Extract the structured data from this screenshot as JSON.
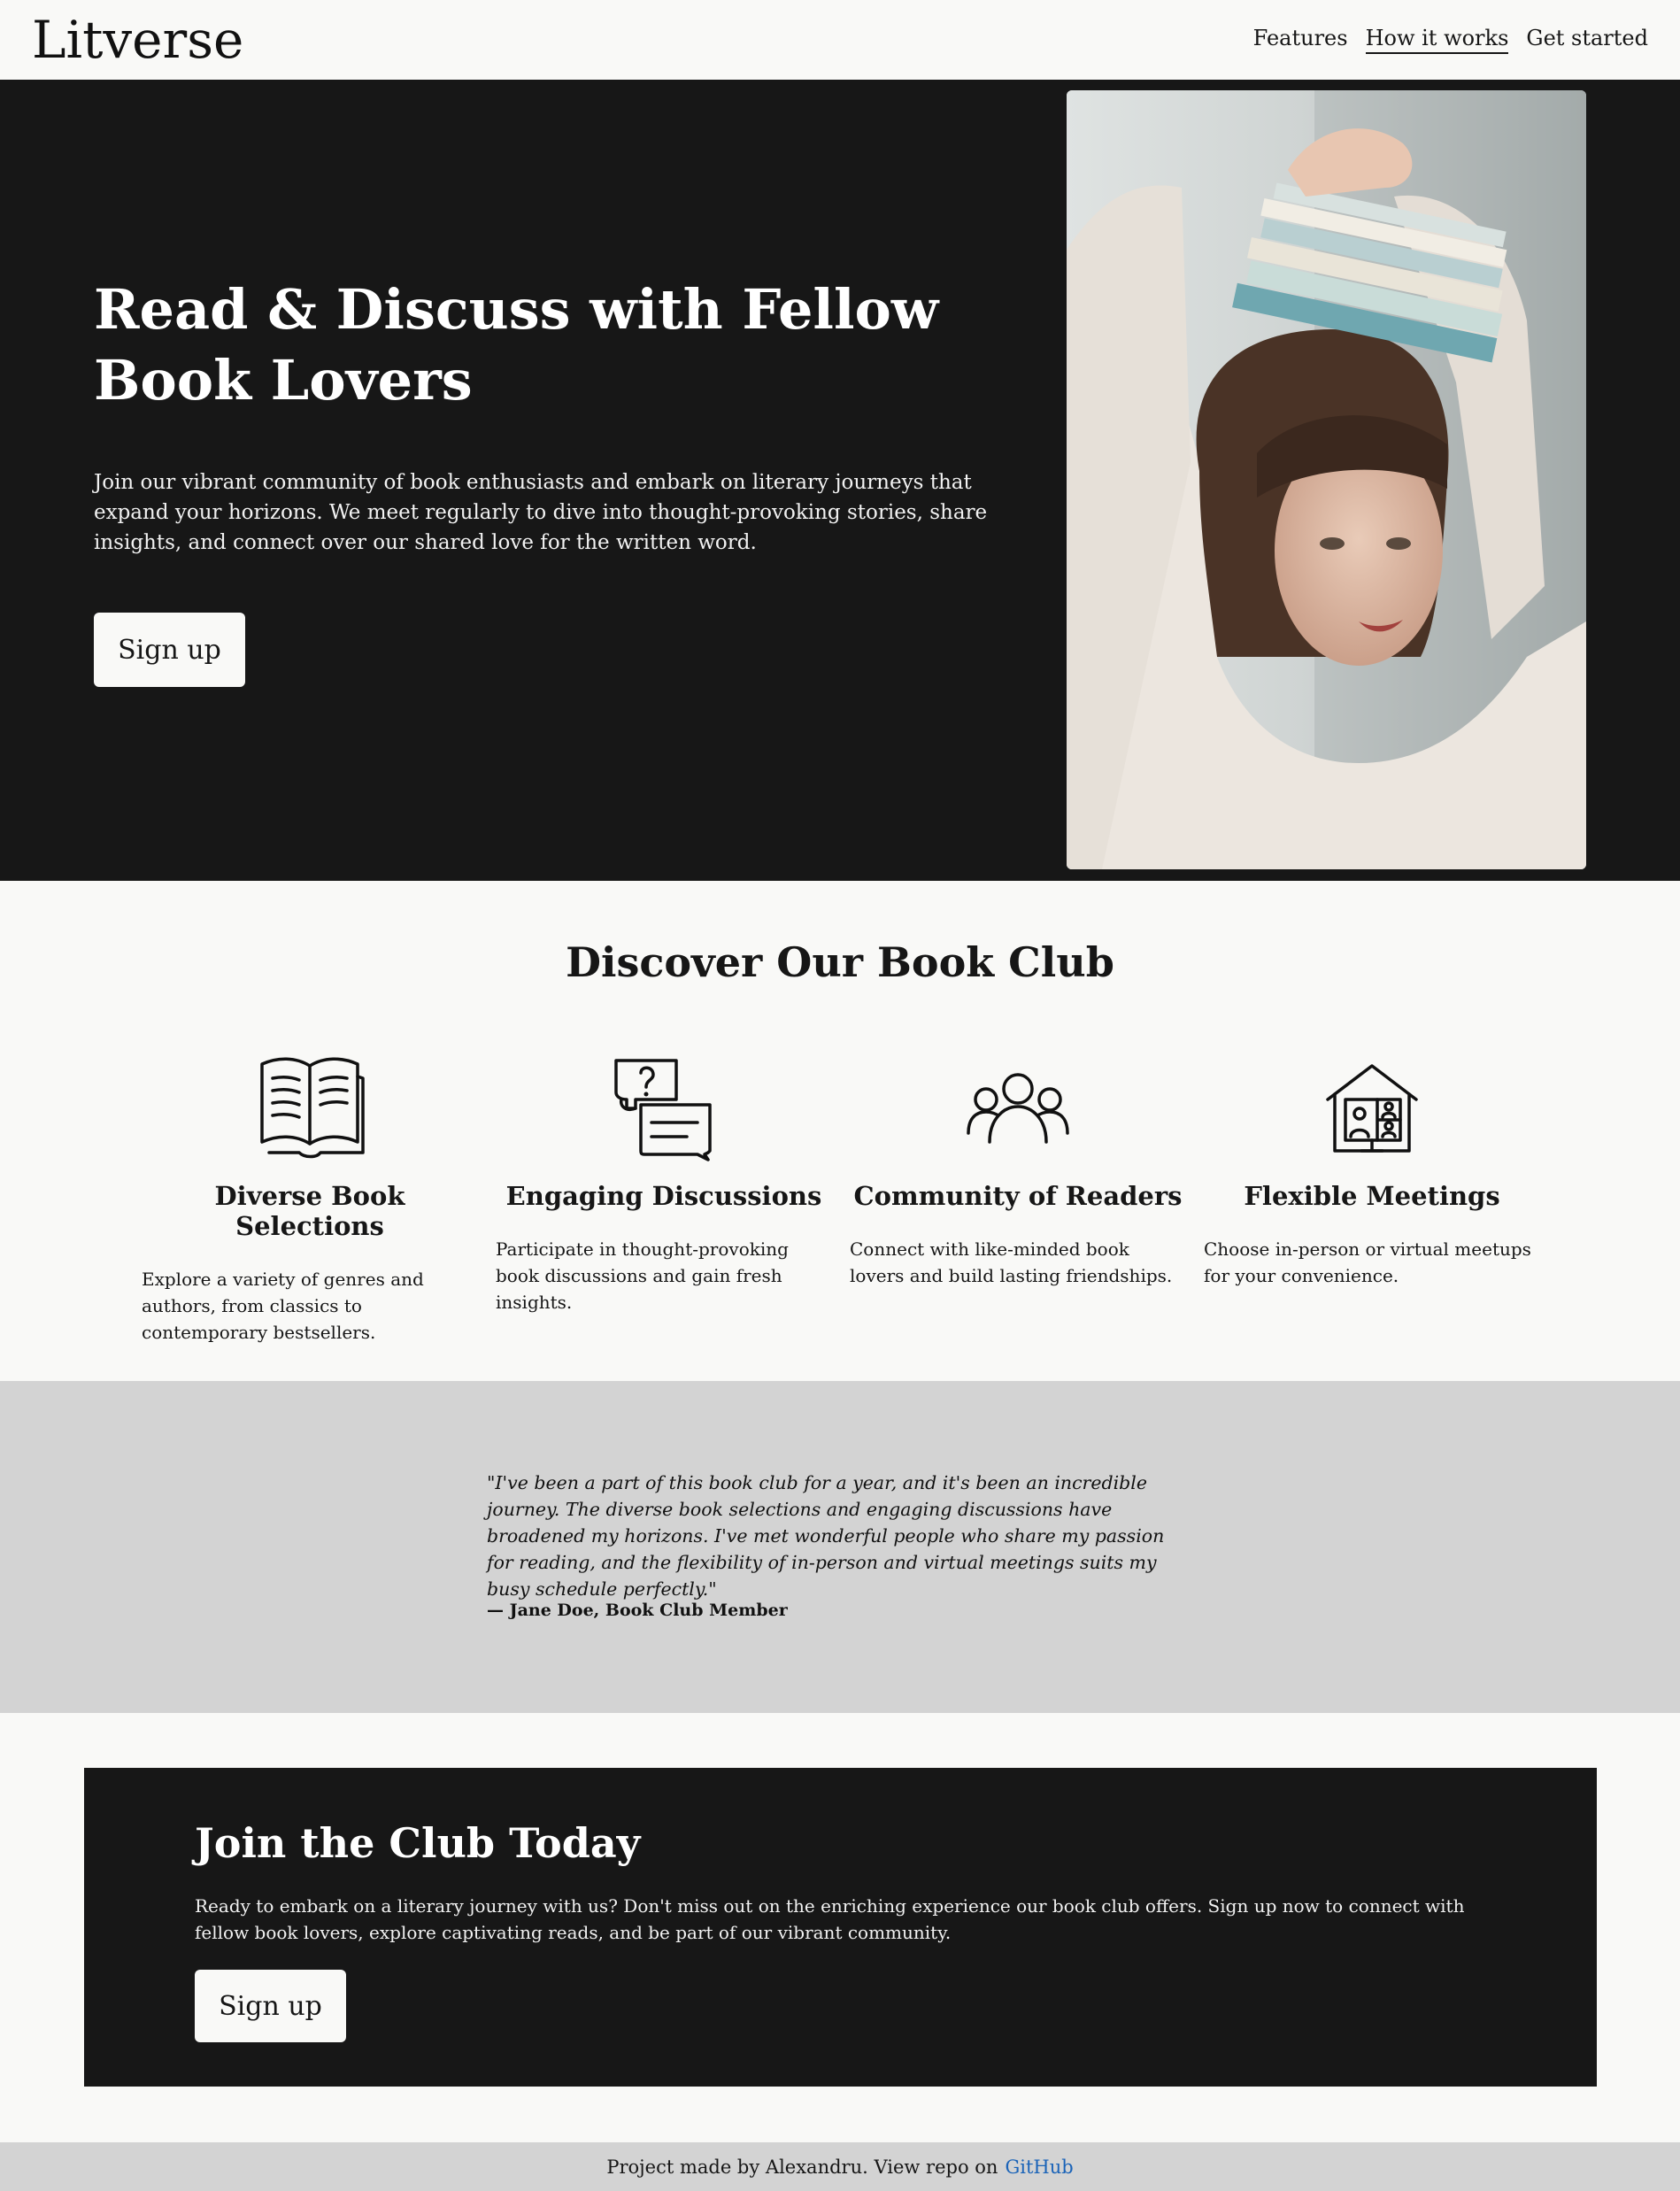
{
  "brand": {
    "name": "Litverse"
  },
  "nav": {
    "links": [
      {
        "label": "Features"
      },
      {
        "label": "How it works"
      },
      {
        "label": "Get started"
      }
    ]
  },
  "hero": {
    "title": "Read & Discuss with Fellow Book Lovers",
    "text": "Join our vibrant community of book enthusiasts and embark on literary journeys that expand your horizons. We meet regularly to dive into thought-provoking stories, share insights, and connect over our shared love for the written word.",
    "button_label": "Sign up",
    "image_icon": "woman-balancing-books-photo"
  },
  "features": {
    "title": "Discover Our Book Club",
    "items": [
      {
        "icon": "open-book-icon",
        "title": "Diverse Book Selections",
        "text": "Explore a variety of genres and authors, from classics to contemporary bestsellers."
      },
      {
        "icon": "chat-question-icon",
        "title": "Engaging Discussions",
        "text": "Participate in thought-provoking book discussions and gain fresh insights."
      },
      {
        "icon": "people-group-icon",
        "title": "Community of Readers",
        "text": "Connect with like-minded book lovers and build lasting friendships."
      },
      {
        "icon": "home-video-call-icon",
        "title": "Flexible Meetings",
        "text": "Choose in-person or virtual meetups for your convenience."
      }
    ]
  },
  "testimonial": {
    "quote": "\"I've been a part of this book club for a year, and it's been an incredible journey. The diverse book selections and engaging discussions have broadened my horizons. I've met wonderful people who share my passion for reading, and the flexibility of in-person and virtual meetings suits my busy schedule perfectly.\"",
    "author": "— Jane Doe, Book Club Member"
  },
  "cta": {
    "title": "Join the Club Today",
    "text": "Ready to embark on a literary journey with us? Don't miss out on the enriching experience our book club offers. Sign up now to connect with fellow book lovers, explore captivating reads, and be part of our vibrant community.",
    "button_label": "Sign up"
  },
  "footer": {
    "text": "Project made by Alexandru. View repo on",
    "link_label": "GitHub"
  },
  "colors": {
    "dark": "#171717",
    "light": "#f9f9f7",
    "gray": "#d3d3d3",
    "link": "#1a63b8"
  }
}
